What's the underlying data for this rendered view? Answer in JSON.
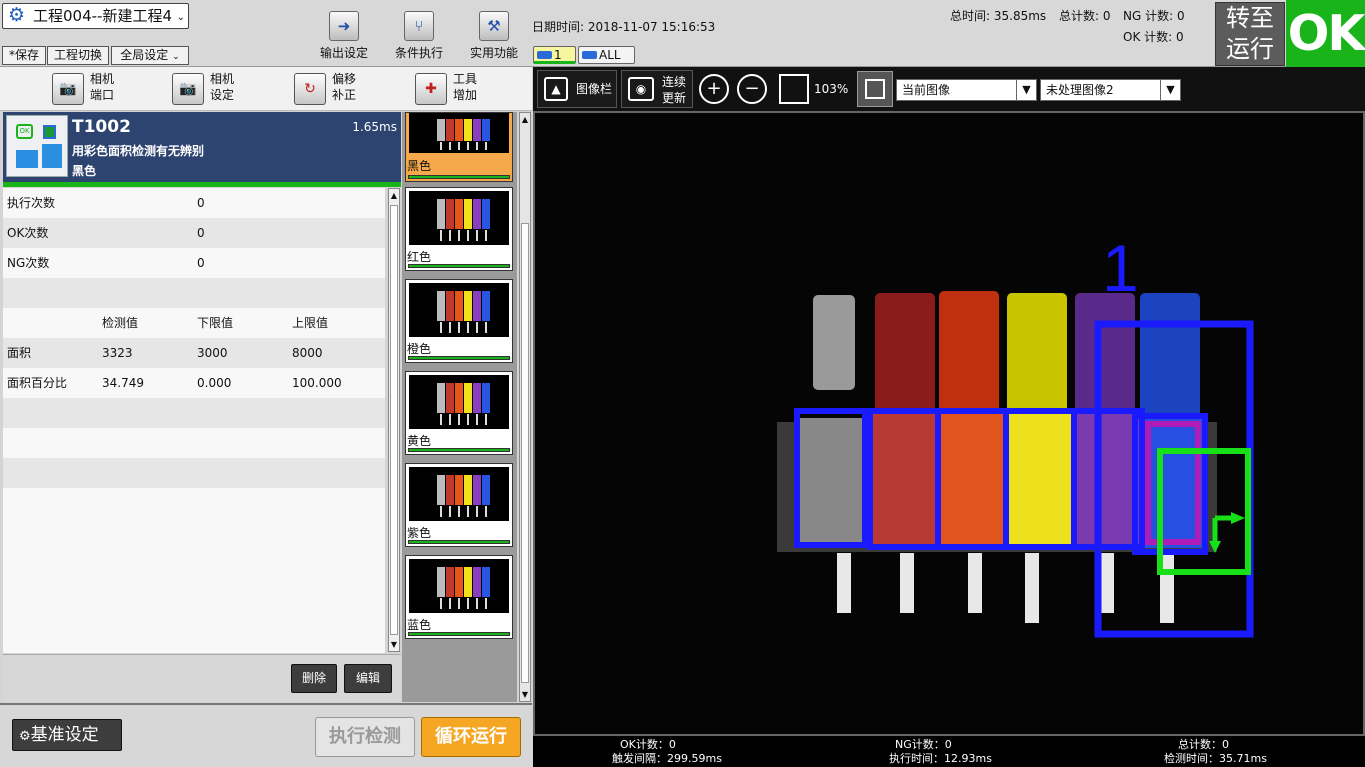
{
  "project": {
    "title": "工程004--新建工程4"
  },
  "toolbar_small": {
    "save": "*保存",
    "switch": "工程切换",
    "global": "全局设定"
  },
  "toolbar_big": {
    "output": "输出设定",
    "condition": "条件执行",
    "utility": "实用功能"
  },
  "status": {
    "datetime": "日期时间: 2018-11-07 15:16:53",
    "total_time": "总时间: 35.85ms",
    "total_count": "总计数: 0",
    "ng_count": "NG 计数: 0",
    "ok_count": "OK 计数: 0",
    "cam1": "1",
    "camall": "ALL"
  },
  "run_button": {
    "line1": "转至",
    "line2": "运行"
  },
  "result": "OK",
  "subtools": [
    {
      "l1": "相机",
      "l2": "端口"
    },
    {
      "l1": "相机",
      "l2": "设定"
    },
    {
      "l1": "偏移",
      "l2": "补正"
    },
    {
      "l1": "工具",
      "l2": "增加"
    }
  ],
  "tool": {
    "id": "T1002",
    "time": "1.65ms",
    "desc": "用彩色面积检测有无辨别",
    "color": "黑色"
  },
  "stats": [
    {
      "label": "执行次数",
      "value": "0"
    },
    {
      "label": "OK次数",
      "value": "0"
    },
    {
      "label": "NG次数",
      "value": "0"
    }
  ],
  "measure": {
    "headers": [
      "检测值",
      "下限值",
      "上限值"
    ],
    "rows": [
      {
        "name": "面积",
        "v": "3323",
        "lo": "3000",
        "hi": "8000"
      },
      {
        "name": "面积百分比",
        "v": "34.749",
        "lo": "0.000",
        "hi": "100.000"
      }
    ]
  },
  "actions": {
    "delete": "删除",
    "edit": "编辑",
    "baseline": "基准设定",
    "execute": "执行检测",
    "loop": "循环运行"
  },
  "thumbs": [
    "黑色",
    "红色",
    "橙色",
    "黄色",
    "紫色",
    "蓝色"
  ],
  "image_toolbar": {
    "imagebar": "图像栏",
    "continuous_l1": "连续",
    "continuous_l2": "更新",
    "zoom": "103%",
    "combo1": "当前图像",
    "combo2": "未处理图像2"
  },
  "overlay": {
    "region_label": "1"
  },
  "footer": {
    "ok": "OK计数：0",
    "trigger": "触发间隔：299.59ms",
    "ng": "NG计数：0",
    "exec": "执行时间：12.93ms",
    "total": "总计数：0",
    "detect": "检测时间：35.71ms"
  },
  "colors": {
    "ok_green": "#19b419",
    "header_blue": "#2d4370",
    "loop_orange": "#f5a623",
    "box_blue": "#1a1aff",
    "box_green": "#18e018",
    "box_magenta": "#b01cb8"
  }
}
